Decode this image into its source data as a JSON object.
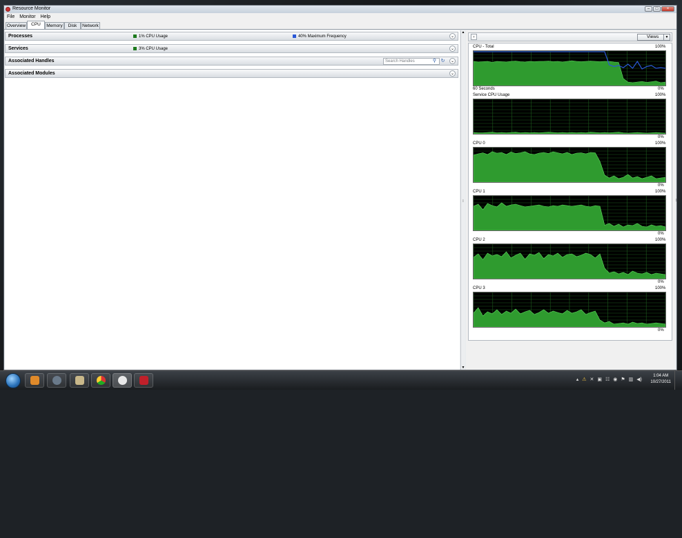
{
  "window": {
    "title": "Resource Monitor"
  },
  "menu": [
    "File",
    "Monitor",
    "Help"
  ],
  "tabs": [
    "Overview",
    "CPU",
    "Memory",
    "Disk",
    "Network"
  ],
  "active_tab": "CPU",
  "sections": {
    "processes": {
      "label": "Processes",
      "cpu_usage": "1% CPU Usage",
      "max_freq": "40% Maximum Frequency"
    },
    "services": {
      "label": "Services",
      "cpu_usage": "3% CPU Usage"
    },
    "handles": {
      "label": "Associated Handles",
      "search_placeholder": "Search Handles"
    },
    "modules": {
      "label": "Associated Modules"
    }
  },
  "views_button": "Views",
  "graphs": [
    {
      "title": "CPU - Total",
      "top": "100%",
      "bottom": "0%",
      "footer": "60 Seconds",
      "key": "total"
    },
    {
      "title": "Service CPU Usage",
      "top": "100%",
      "bottom": "0%",
      "key": "service"
    },
    {
      "title": "CPU 0",
      "top": "100%",
      "bottom": "0%",
      "key": "cpu0"
    },
    {
      "title": "CPU 1",
      "top": "100%",
      "bottom": "0%",
      "key": "cpu1"
    },
    {
      "title": "CPU 2",
      "top": "100%",
      "bottom": "0%",
      "key": "cpu2"
    },
    {
      "title": "CPU 3",
      "top": "100%",
      "bottom": "0%",
      "key": "cpu3"
    }
  ],
  "series": {
    "total": [
      70,
      68,
      69,
      70,
      67,
      70,
      69,
      68,
      70,
      71,
      69,
      68,
      70,
      69,
      70,
      70,
      71,
      69,
      70,
      68,
      70,
      72,
      70,
      69,
      70,
      71,
      70,
      69,
      70,
      70,
      68,
      67,
      20,
      10,
      8,
      10,
      12,
      9,
      11,
      13,
      8,
      10
    ],
    "service": [
      4,
      3,
      3,
      4,
      5,
      3,
      4,
      3,
      4,
      5,
      3,
      4,
      3,
      4,
      3,
      4,
      5,
      4,
      3,
      4,
      3,
      4,
      3,
      4,
      3,
      5,
      4,
      3,
      4,
      3,
      4,
      5,
      3,
      2,
      3,
      4,
      3,
      2,
      3,
      4,
      3,
      2
    ],
    "cpu0": [
      78,
      82,
      85,
      80,
      88,
      84,
      86,
      80,
      87,
      83,
      85,
      88,
      82,
      80,
      84,
      86,
      83,
      88,
      85,
      82,
      86,
      80,
      84,
      85,
      82,
      86,
      85,
      60,
      20,
      12,
      18,
      10,
      14,
      22,
      12,
      16,
      10,
      14,
      18,
      10,
      12,
      14
    ],
    "cpu1": [
      70,
      76,
      60,
      78,
      72,
      68,
      80,
      70,
      74,
      76,
      72,
      68,
      70,
      72,
      74,
      70,
      68,
      72,
      70,
      74,
      72,
      70,
      72,
      74,
      70,
      68,
      72,
      70,
      15,
      20,
      12,
      18,
      10,
      16,
      14,
      20,
      12,
      10,
      16,
      12,
      14,
      10
    ],
    "cpu2": [
      62,
      72,
      55,
      74,
      66,
      70,
      64,
      78,
      60,
      68,
      74,
      56,
      72,
      68,
      76,
      58,
      70,
      66,
      74,
      62,
      70,
      72,
      64,
      68,
      74,
      70,
      60,
      72,
      30,
      16,
      20,
      14,
      18,
      12,
      22,
      16,
      14,
      18,
      12,
      16,
      14,
      12
    ],
    "cpu3": [
      40,
      56,
      32,
      44,
      38,
      50,
      36,
      46,
      40,
      52,
      38,
      44,
      48,
      36,
      42,
      50,
      40,
      46,
      42,
      38,
      48,
      40,
      44,
      50,
      36,
      42,
      46,
      20,
      12,
      16,
      8,
      10,
      12,
      8,
      14,
      10,
      12,
      8,
      10,
      12,
      10,
      8
    ],
    "total_freq": [
      98,
      98,
      98,
      98,
      98,
      98,
      98,
      98,
      98,
      98,
      98,
      98,
      98,
      98,
      98,
      98,
      98,
      98,
      98,
      98,
      98,
      98,
      98,
      98,
      98,
      98,
      98,
      98,
      98,
      60,
      55,
      58,
      52,
      62,
      50,
      70,
      48,
      55,
      58,
      50,
      52,
      50
    ]
  },
  "colors": {
    "usage": "#2f9b2f",
    "freq": "#2a58d6",
    "grid": "#1c5a1c"
  },
  "tray": {
    "time": "1:04 AM",
    "date": "10/27/2011"
  },
  "taskbar_apps": [
    "media-player-icon",
    "steam-icon",
    "game-icon",
    "chrome-icon",
    "app-icon",
    "flash-icon"
  ]
}
